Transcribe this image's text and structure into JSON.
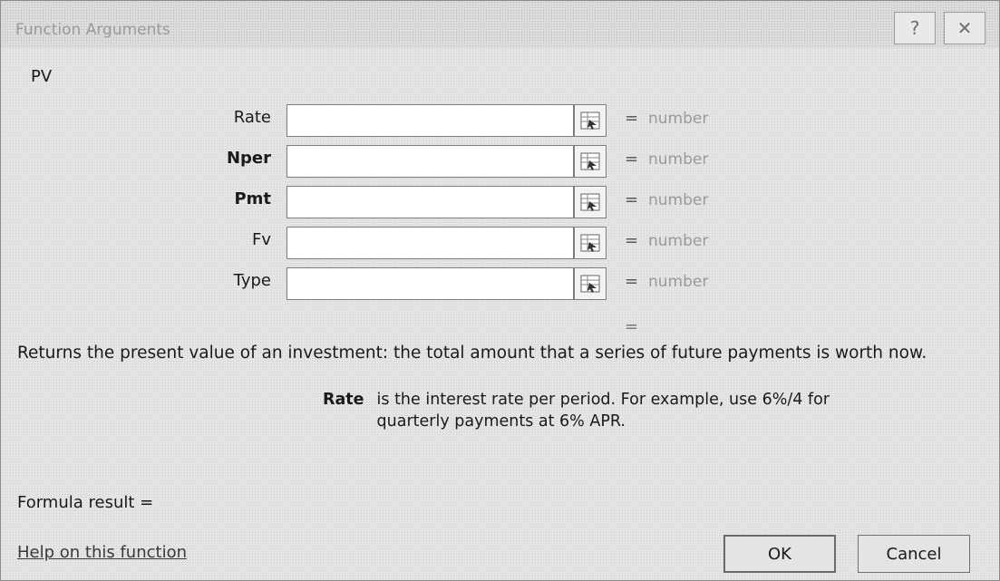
{
  "dialog": {
    "title": "Function Arguments",
    "help_icon": "?",
    "close_icon": "X"
  },
  "function_name": "PV",
  "arguments": [
    {
      "label": "Rate",
      "value": "",
      "hint": "number",
      "required": false
    },
    {
      "label": "Nper",
      "value": "",
      "hint": "number",
      "required": true
    },
    {
      "label": "Pmt",
      "value": "",
      "hint": "number",
      "required": true
    },
    {
      "label": "Fv",
      "value": "",
      "hint": "number",
      "required": false
    },
    {
      "label": "Type",
      "value": "",
      "hint": "number",
      "required": false
    }
  ],
  "equals_sign": "=",
  "description": "Returns the present value of an investment: the total amount that a series of future payments is worth now.",
  "arg_help": {
    "name": "Rate",
    "text": "is the interest rate per period. For example, use 6%/4 for quarterly payments at 6% APR."
  },
  "formula_result_label": "Formula result =",
  "help_link": "Help on this function",
  "buttons": {
    "ok": "OK",
    "cancel": "Cancel"
  }
}
